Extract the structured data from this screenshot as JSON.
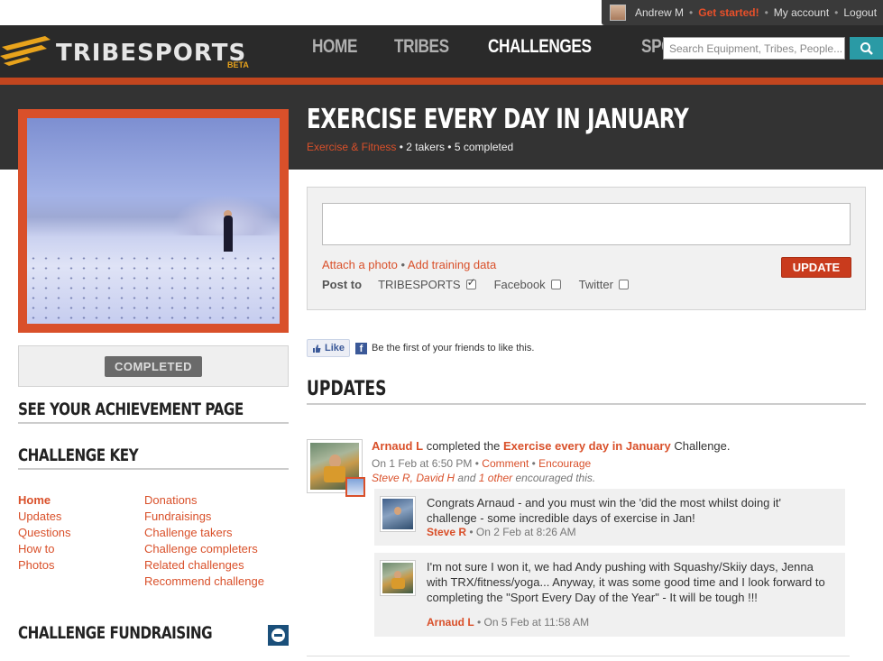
{
  "userbar": {
    "name": "Andrew M",
    "get_started": "Get started!",
    "my_account": "My account",
    "logout": "Logout"
  },
  "header": {
    "logo": "TRIBESPORTS",
    "beta": "BETA",
    "nav": [
      "HOME",
      "TRIBES",
      "CHALLENGES",
      "SPORTS"
    ],
    "active_nav": "CHALLENGES",
    "search_placeholder": "Search Equipment, Tribes, People..."
  },
  "challenge": {
    "title": "EXERCISE EVERY DAY IN JANUARY",
    "category": "Exercise & Fitness",
    "takers": "2 takers",
    "completed": "5 completed",
    "status_button": "COMPLETED"
  },
  "sidebar": {
    "achievement": "SEE YOUR ACHIEVEMENT PAGE",
    "key_title": "CHALLENGE KEY",
    "key_col1": [
      "Home",
      "Updates",
      "Questions",
      "How to",
      "Photos"
    ],
    "key_col2": [
      "Donations",
      "Fundraisings",
      "Challenge takers",
      "Challenge completers",
      "Related challenges",
      "Recommend challenge"
    ],
    "fundraising_title": "CHALLENGE FUNDRAISING"
  },
  "update_form": {
    "attach_photo": "Attach a photo",
    "add_training": "Add training data",
    "update_button": "UPDATE",
    "post_to_label": "Post to",
    "targets": [
      {
        "label": "TRIBESPORTS",
        "checked": true
      },
      {
        "label": "Facebook",
        "checked": false
      },
      {
        "label": "Twitter",
        "checked": false
      }
    ]
  },
  "facebook": {
    "like": "Like",
    "text": "Be the first of your friends to like this."
  },
  "updates": {
    "title": "UPDATES",
    "post": {
      "author": "Arnaud L",
      "action": "completed the",
      "challenge": "Exercise every day in January",
      "suffix": "Challenge.",
      "time": "On 1 Feb at 6:50 PM",
      "comment": "Comment",
      "encourage": "Encourage",
      "encouragers": "Steve R, David H",
      "and": "and",
      "other": "1 other",
      "encouraged": "encouraged this."
    },
    "comments": [
      {
        "text": "Congrats Arnaud - and you must win the 'did the most whilst doing it' challenge - some incredible days of exercise in Jan!",
        "author": "Steve R",
        "time": "On 2 Feb at 8:26 AM"
      },
      {
        "text": "I'm not sure I won it, we had Andy pushing with Squashy/Skiiy days, Jenna with TRX/fitness/yoga... Anyway, it was some good time and I look forward to completing the \"Sport Every Day of the Year\" - It will be tough !!!",
        "author": "Arnaud L",
        "time": "On 5 Feb at 11:58 AM"
      }
    ]
  }
}
